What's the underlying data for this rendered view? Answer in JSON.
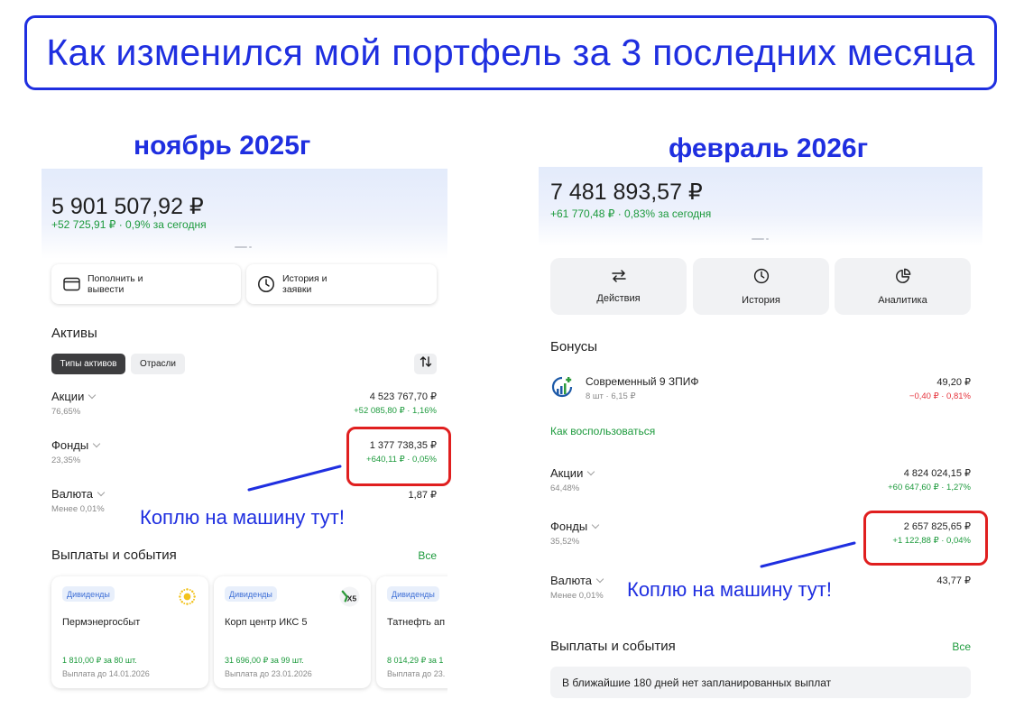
{
  "banner": {
    "title": "Как изменился мой портфель за 3 последних месяца"
  },
  "annotations": {
    "left": "Коплю на машину тут!",
    "right": "Коплю на машину тут!"
  },
  "left": {
    "month": "ноябрь 2025г",
    "total": "5 901 507,92 ₽",
    "change": "+52 725,91 ₽ · 0,9%",
    "change_suffix": "за сегодня",
    "buttons": {
      "deposit": "Пополнить и вывести",
      "history": "История и заявки"
    },
    "assets_title": "Активы",
    "chips": {
      "types": "Типы активов",
      "sectors": "Отрасли"
    },
    "rows": [
      {
        "name": "Акции",
        "share": "76,65%",
        "value": "4 523 767,70 ₽",
        "change": "+52 085,80 ₽ · 1,16%"
      },
      {
        "name": "Фонды",
        "share": "23,35%",
        "value": "1 377 738,35 ₽",
        "change": "+640,11 ₽ · 0,05%"
      },
      {
        "name": "Валюта",
        "share": "Менее 0,01%",
        "value": "1,87 ₽",
        "change": ""
      }
    ],
    "events_title": "Выплаты и события",
    "events_all": "Все",
    "cards": [
      {
        "badge": "Дивиденды",
        "title": "Пермэнергосбыт",
        "amount": "1 810,00 ₽ за 80 шт.",
        "date": "Выплата до 14.01.2026",
        "logo": "sun-logo-icon"
      },
      {
        "badge": "Дивиденды",
        "title": "Корп центр ИКС 5",
        "amount": "31 696,00 ₽ за 99 шт.",
        "date": "Выплата до 23.01.2026",
        "logo": "x5-logo-icon"
      },
      {
        "badge": "Дивиденды",
        "title": "Татнефть ап",
        "amount": "8 014,29 ₽ за 1",
        "date": "Выплата до 23.",
        "logo": ""
      }
    ],
    "colors": {
      "green": "#1c9a3c",
      "accent_blue": "#1f2fe0",
      "highlight_red": "#e01f1f"
    }
  },
  "right": {
    "month": "февраль 2026г",
    "total": "7 481 893,57 ₽",
    "change": "+61 770,48 ₽ · 0,83%",
    "change_suffix": "за сегодня",
    "tiles": [
      {
        "label": "Действия",
        "icon": "arrows-swap-icon"
      },
      {
        "label": "История",
        "icon": "clock-icon"
      },
      {
        "label": "Аналитика",
        "icon": "pie-chart-icon"
      }
    ],
    "bonuses_title": "Бонусы",
    "bonus": {
      "name": "Современный 9 ЗПИФ",
      "sub": "8 шт · 6,15 ₽",
      "value": "49,20 ₽",
      "change": "−0,40 ₽ · 0,81%"
    },
    "how_to": "Как воспользоваться",
    "rows": [
      {
        "name": "Акции",
        "share": "64,48%",
        "value": "4 824 024,15 ₽",
        "change": "+60 647,60 ₽ · 1,27%"
      },
      {
        "name": "Фонды",
        "share": "35,52%",
        "value": "2 657 825,65 ₽",
        "change": "+1 122,88 ₽ · 0,04%"
      },
      {
        "name": "Валюта",
        "share": "Менее 0,01%",
        "value": "43,77 ₽",
        "change": ""
      }
    ],
    "events_title": "Выплаты и события",
    "events_all": "Все",
    "no_payments": "В ближайшие 180 дней нет запланированных выплат",
    "colors": {
      "red": "#e5333c"
    }
  }
}
